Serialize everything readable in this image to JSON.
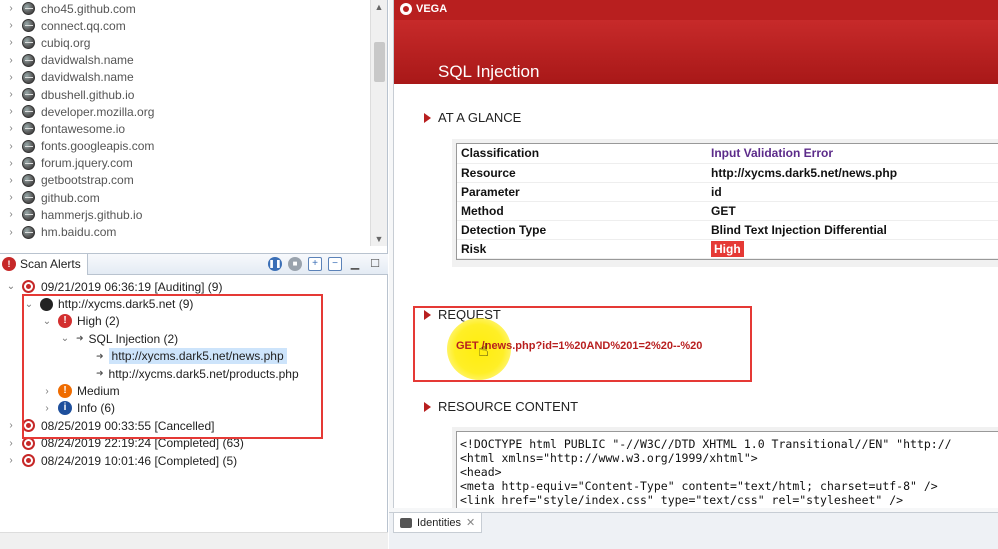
{
  "host_list": [
    "cho45.github.com",
    "connect.qq.com",
    "cubiq.org",
    "davidwalsh.name",
    "davidwalsh.name",
    "dbushell.github.io",
    "developer.mozilla.org",
    "fontawesome.io",
    "fonts.googleapis.com",
    "forum.jquery.com",
    "getbootstrap.com",
    "github.com",
    "hammerjs.github.io",
    "hm.baidu.com"
  ],
  "scan_alerts": {
    "tab_label": "Scan Alerts",
    "scans": {
      "s1": "09/21/2019 06:36:19 [Auditing]  (9)",
      "host": "http://xycms.dark5.net (9)",
      "high": "High (2)",
      "sqli": "SQL Injection (2)",
      "url1": "http://xycms.dark5.net/news.php",
      "url2": "http://xycms.dark5.net/products.php",
      "medium": "Medium",
      "info": "Info (6)",
      "s2": "08/25/2019 00:33:55 [Cancelled]",
      "s3": "08/24/2019 22:19:24 [Completed]  (63)",
      "s4": "08/24/2019 10:01:46 [Completed]  (5)"
    }
  },
  "report": {
    "logo": "VEGA",
    "title": "SQL Injection",
    "at_a_glance": "AT A GLANCE",
    "glance_rows": {
      "classification_k": "Classification",
      "classification_v": "Input Validation Error",
      "resource_k": "Resource",
      "resource_v": "http://xycms.dark5.net/news.php",
      "parameter_k": "Parameter",
      "parameter_v": "id",
      "method_k": "Method",
      "method_v": "GET",
      "detection_k": "Detection Type",
      "detection_v": "Blind Text Injection Differential",
      "risk_k": "Risk",
      "risk_v": "High"
    },
    "request_head": "REQUEST",
    "request_text": "GET /news.php?id=1%20AND%201=2%20--%20",
    "resource_head": "RESOURCE CONTENT",
    "code_lines": [
      "<!DOCTYPE html PUBLIC \"-//W3C//DTD XHTML 1.0 Transitional//EN\" \"http://",
      "<html xmlns=\"http://www.w3.org/1999/xhtml\">",
      "<head>",
      "<meta http-equiv=\"Content-Type\" content=\"text/html; charset=utf-8\" />",
      "<link href=\"style/index.css\" type=\"text/css\" rel=\"stylesheet\" />"
    ]
  },
  "identities_tab": "Identities",
  "colors": {
    "vega_red": "#b81f1f",
    "risk_high": "#e53935",
    "selection": "#cde4fb"
  }
}
